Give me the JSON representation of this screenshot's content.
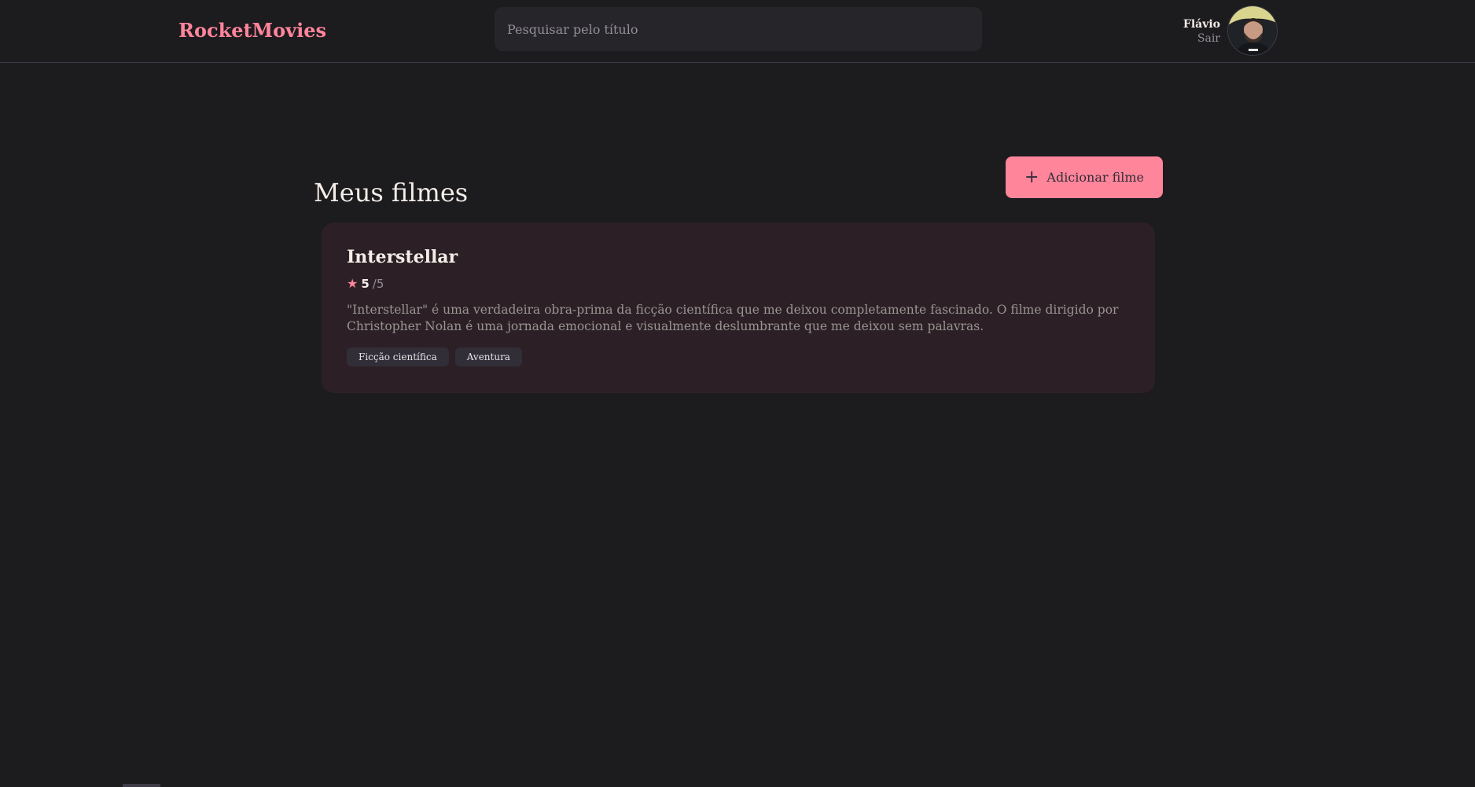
{
  "header": {
    "brand": "RocketMovies",
    "search_placeholder": "Pesquisar pelo título",
    "user": {
      "name": "Flávio",
      "logout_label": "Sair"
    }
  },
  "main": {
    "title": "Meus filmes",
    "add_button_label": "Adicionar filme",
    "movies": [
      {
        "title": "Interstellar",
        "rating": "5",
        "rating_max": "/5",
        "description": "\"Interstellar\" é uma verdadeira obra-prima da ficção científica que me deixou completamente fascinado. O filme dirigido por Christopher Nolan é uma jornada emocional e visualmente deslumbrante que me deixou sem palavras.",
        "tags": [
          "Ficção científica",
          "Aventura"
        ]
      }
    ]
  },
  "colors": {
    "background": "#1c1b1e",
    "accent": "#ff859b",
    "card": "#2c2026",
    "tag": "#312e38"
  },
  "icons": {
    "plus": "plus-icon",
    "star": "star-icon"
  }
}
